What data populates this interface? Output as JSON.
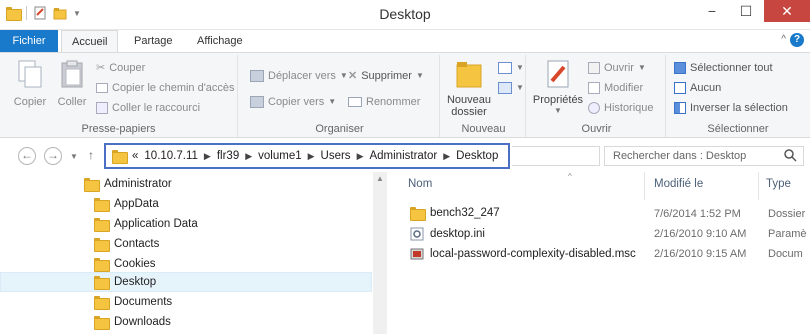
{
  "window": {
    "title": "Desktop"
  },
  "tabs": [
    "Fichier",
    "Accueil",
    "Partage",
    "Affichage"
  ],
  "ribbon": {
    "clipboard": {
      "copy": "Copier",
      "paste": "Coller",
      "cut": "Couper",
      "copy_path": "Copier le chemin d'accès",
      "paste_shortcut": "Coller le raccourci",
      "label": "Presse-papiers"
    },
    "organize": {
      "move": "Déplacer vers",
      "copy_to": "Copier vers",
      "delete": "Supprimer",
      "rename": "Renommer",
      "label": "Organiser"
    },
    "new": {
      "new_folder_l1": "Nouveau",
      "new_folder_l2": "dossier",
      "label": "Nouveau"
    },
    "open": {
      "properties": "Propriétés",
      "open": "Ouvrir",
      "edit": "Modifier",
      "history": "Historique",
      "label": "Ouvrir"
    },
    "select": {
      "select_all": "Sélectionner tout",
      "none": "Aucun",
      "invert": "Inverser la sélection",
      "label": "Sélectionner"
    }
  },
  "address": {
    "overflow": "«",
    "crumbs": [
      "10.10.7.11",
      "flr39",
      "volume1",
      "Users",
      "Administrator",
      "Desktop"
    ]
  },
  "search": {
    "placeholder": "Rechercher dans : Desktop"
  },
  "tree": {
    "root": "Administrator",
    "items": [
      "AppData",
      "Application Data",
      "Contacts",
      "Cookies",
      "Desktop",
      "Documents",
      "Downloads"
    ],
    "selected": "Desktop"
  },
  "files": {
    "columns": {
      "name": "Nom",
      "modified": "Modifié le",
      "type": "Type"
    },
    "rows": [
      {
        "name": "bench32_247",
        "modified": "7/6/2014 1:52 PM",
        "type": "Dossier",
        "icon": "folder-icon"
      },
      {
        "name": "desktop.ini",
        "modified": "2/16/2010 9:10 AM",
        "type": "Paramè",
        "icon": "settings-file-icon"
      },
      {
        "name": "local-password-complexity-disabled.msc",
        "modified": "2/16/2010 9:15 AM",
        "type": "Docum",
        "icon": "msc-console-icon"
      }
    ]
  },
  "colors": {
    "file_tab": "#1979ca",
    "address_border": "#4b6fc5",
    "selection": "#e5f3fb",
    "close": "#c7463f"
  }
}
